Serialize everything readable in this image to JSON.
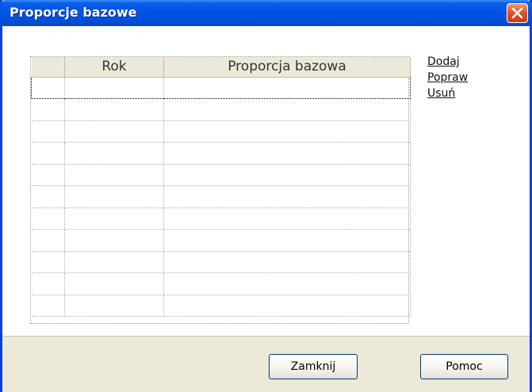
{
  "window": {
    "title": "Proporcje bazowe",
    "close_icon": "close-x-icon"
  },
  "grid": {
    "columns": [
      "",
      "Rok",
      "Proporcja bazowa"
    ],
    "rows": [
      [
        "",
        "",
        ""
      ],
      [
        "",
        "",
        ""
      ],
      [
        "",
        "",
        ""
      ],
      [
        "",
        "",
        ""
      ],
      [
        "",
        "",
        ""
      ],
      [
        "",
        "",
        ""
      ],
      [
        "",
        "",
        ""
      ],
      [
        "",
        "",
        ""
      ],
      [
        "",
        "",
        ""
      ],
      [
        "",
        "",
        ""
      ],
      [
        "",
        "",
        ""
      ]
    ]
  },
  "links": {
    "add": "Dodaj",
    "edit": "Popraw",
    "delete": "Usuń"
  },
  "buttons": {
    "close": "Zamknij",
    "help": "Pomoc"
  },
  "colors": {
    "titlebar": "#0054e3",
    "close_button": "#e2542b",
    "dialog_face": "#ece9d8"
  }
}
